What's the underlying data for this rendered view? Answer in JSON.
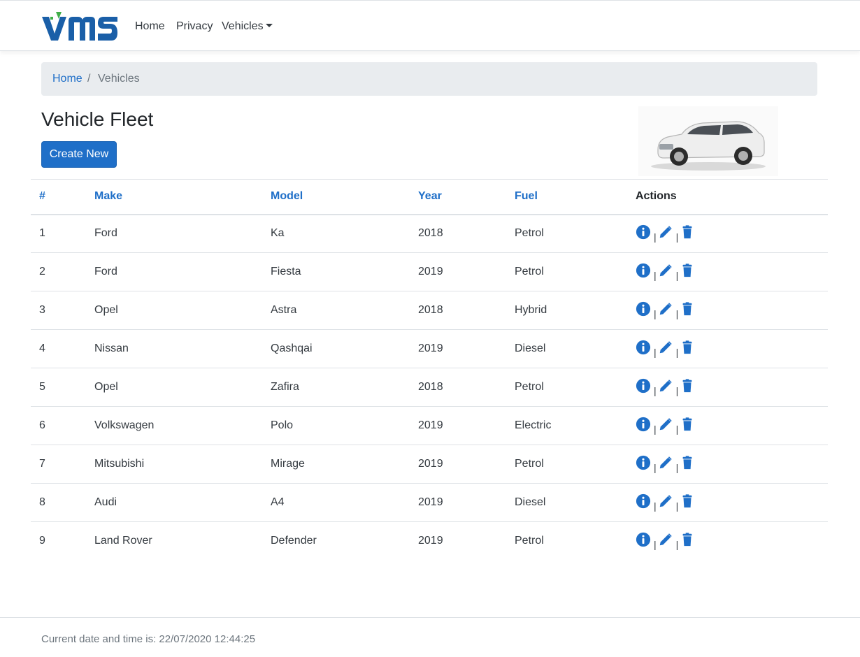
{
  "brand": {
    "logo_text": "VMS"
  },
  "nav": {
    "home": "Home",
    "privacy": "Privacy",
    "vehicles": "Vehicles"
  },
  "breadcrumb": {
    "home": "Home",
    "separator": "/",
    "current": "Vehicles"
  },
  "page": {
    "title": "Vehicle Fleet",
    "create_button": "Create New"
  },
  "table": {
    "headers": {
      "num": "#",
      "make": "Make",
      "model": "Model",
      "year": "Year",
      "fuel": "Fuel",
      "actions": "Actions"
    },
    "rows": [
      {
        "num": "1",
        "make": "Ford",
        "model": "Ka",
        "year": "2018",
        "fuel": "Petrol"
      },
      {
        "num": "2",
        "make": "Ford",
        "model": "Fiesta",
        "year": "2019",
        "fuel": "Petrol"
      },
      {
        "num": "3",
        "make": "Opel",
        "model": "Astra",
        "year": "2018",
        "fuel": "Hybrid"
      },
      {
        "num": "4",
        "make": "Nissan",
        "model": "Qashqai",
        "year": "2019",
        "fuel": "Diesel"
      },
      {
        "num": "5",
        "make": "Opel",
        "model": "Zafira",
        "year": "2018",
        "fuel": "Petrol"
      },
      {
        "num": "6",
        "make": "Volkswagen",
        "model": "Polo",
        "year": "2019",
        "fuel": "Electric"
      },
      {
        "num": "7",
        "make": "Mitsubishi",
        "model": "Mirage",
        "year": "2019",
        "fuel": "Petrol"
      },
      {
        "num": "8",
        "make": "Audi",
        "model": "A4",
        "year": "2019",
        "fuel": "Diesel"
      },
      {
        "num": "9",
        "make": "Land Rover",
        "model": "Defender",
        "year": "2019",
        "fuel": "Petrol"
      }
    ],
    "action_separator": "|",
    "action_icons": [
      "info-circle-icon",
      "pencil-icon",
      "trash-icon"
    ]
  },
  "footer": {
    "text": "Current date and time is: 22/07/2020 12:44:25"
  },
  "colors": {
    "primary": "#1f6fc8",
    "logo_blue": "#1a5fa8",
    "logo_green": "#3fae49",
    "breadcrumb_bg": "#e9ecef",
    "muted": "#6c757d"
  }
}
